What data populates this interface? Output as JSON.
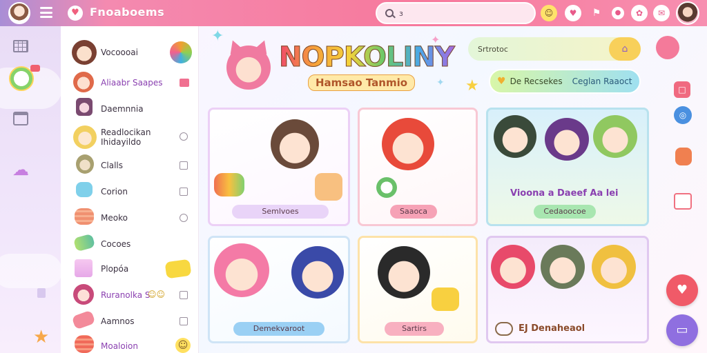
{
  "app": {
    "brand": "Fnoaboems",
    "search_placeholder": "",
    "search_value": "ɜ"
  },
  "sidebar": {
    "items": [
      {
        "label": "Vocoooai",
        "control": "badge"
      },
      {
        "label": "Aliaabr Saapes",
        "control": "tag"
      },
      {
        "label": "Daemnnia",
        "control": "none"
      },
      {
        "label": "Readlocikan\nIhidayildo",
        "control": "radio"
      },
      {
        "label": "Clalls",
        "control": "checkbox"
      },
      {
        "label": "Corion",
        "control": "checkbox"
      },
      {
        "label": "Meoko",
        "control": "radio"
      },
      {
        "label": "Cocoes",
        "control": "none"
      },
      {
        "label": "Plopóa",
        "control": "sticker"
      },
      {
        "label": "Ruranolka S",
        "control": "checkbox"
      },
      {
        "label": "Aamnos",
        "control": "checkbox"
      },
      {
        "label": "Moaloion",
        "control": "smiley"
      }
    ]
  },
  "hero": {
    "title": "NOPKOLINY",
    "subtitle": "Hamsao Tanmio"
  },
  "tools": {
    "search_value": "Srtrotoc",
    "pill_left": "De Recsekes",
    "pill_right": "Ceglan Raaoct"
  },
  "cards": [
    {
      "button": "Semlvoes"
    },
    {
      "button": "Saaoca"
    },
    {
      "title": "Vioona a Daeef Aa lei",
      "button": "Cedaoocoe"
    },
    {
      "button": "Demekvaroot"
    },
    {
      "button": "Sartirs"
    },
    {
      "title": "EJ Denaheaol",
      "button": ""
    }
  ],
  "colors": {
    "topbar": "#f7799c",
    "accent_pink": "#f06888",
    "accent_purple": "#a46ae0",
    "fab_red": "#f05a68",
    "fab_purple": "#8f6fe0"
  }
}
